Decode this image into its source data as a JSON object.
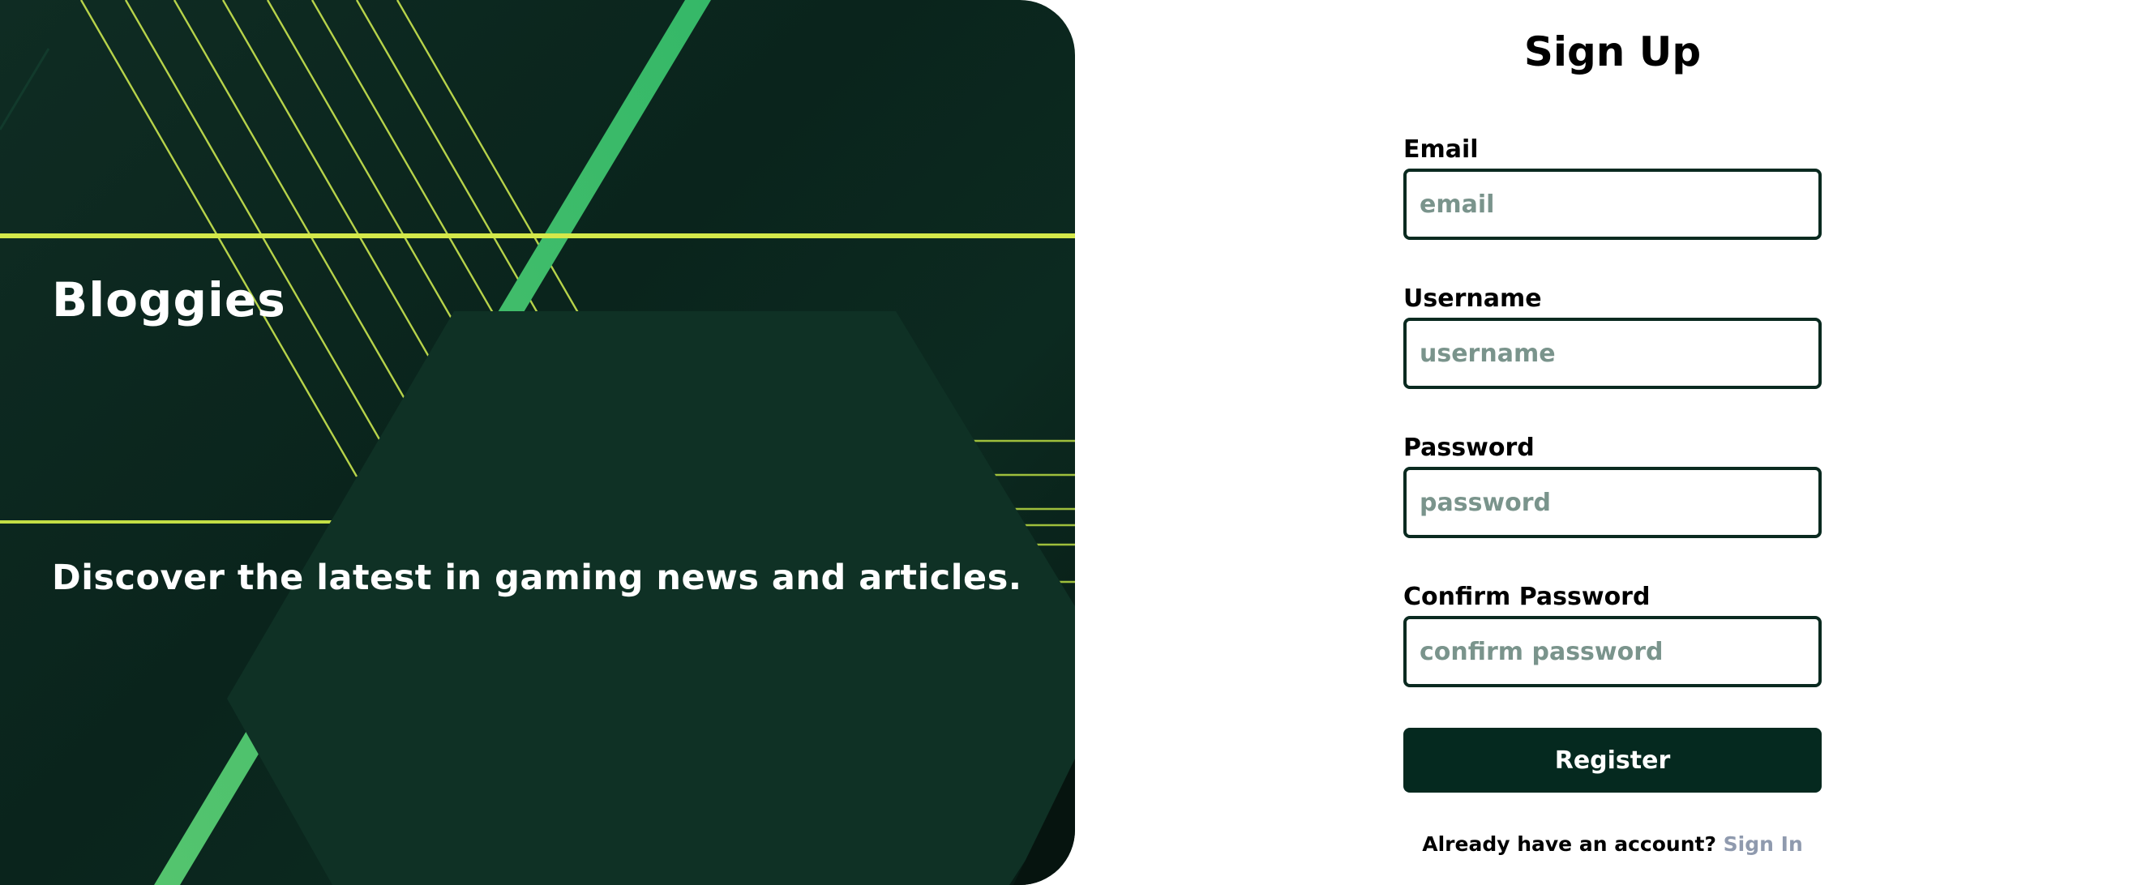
{
  "hero": {
    "brand": "Bloggies",
    "tagline": "Discover the latest in gaming news and articles."
  },
  "form": {
    "title": "Sign Up",
    "fields": [
      {
        "label": "Email",
        "placeholder": "email",
        "type": "email"
      },
      {
        "label": "Username",
        "placeholder": "username",
        "type": "text"
      },
      {
        "label": "Password",
        "placeholder": "password",
        "type": "password"
      },
      {
        "label": "Confirm Password",
        "placeholder": "confirm password",
        "type": "password"
      }
    ],
    "submit_label": "Register",
    "signin_prompt": "Already have an account?",
    "signin_link": "Sign In"
  },
  "colors": {
    "hero_background": "#0a241c",
    "hexagon": "#0f3025",
    "accent_green": "#3dbb6b",
    "accent_lime": "#d4e84a",
    "button": "#05291f",
    "input_border": "#0a2a20",
    "placeholder": "#7a948c",
    "link": "#8f9aae"
  }
}
